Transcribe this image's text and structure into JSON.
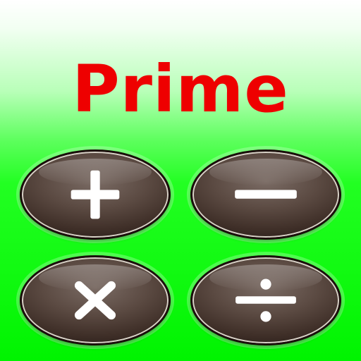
{
  "app": {
    "title": "Prime"
  },
  "buttons": [
    {
      "id": "add",
      "icon": "plus-icon"
    },
    {
      "id": "subtract",
      "icon": "minus-icon"
    },
    {
      "id": "multiply",
      "icon": "multiply-icon"
    },
    {
      "id": "divide",
      "icon": "divide-icon"
    }
  ],
  "colors": {
    "title": "#ee0000",
    "background_top": "#ffffff",
    "background_bottom": "#00f400",
    "button": "#5b4a42",
    "symbol": "#ffffff"
  }
}
